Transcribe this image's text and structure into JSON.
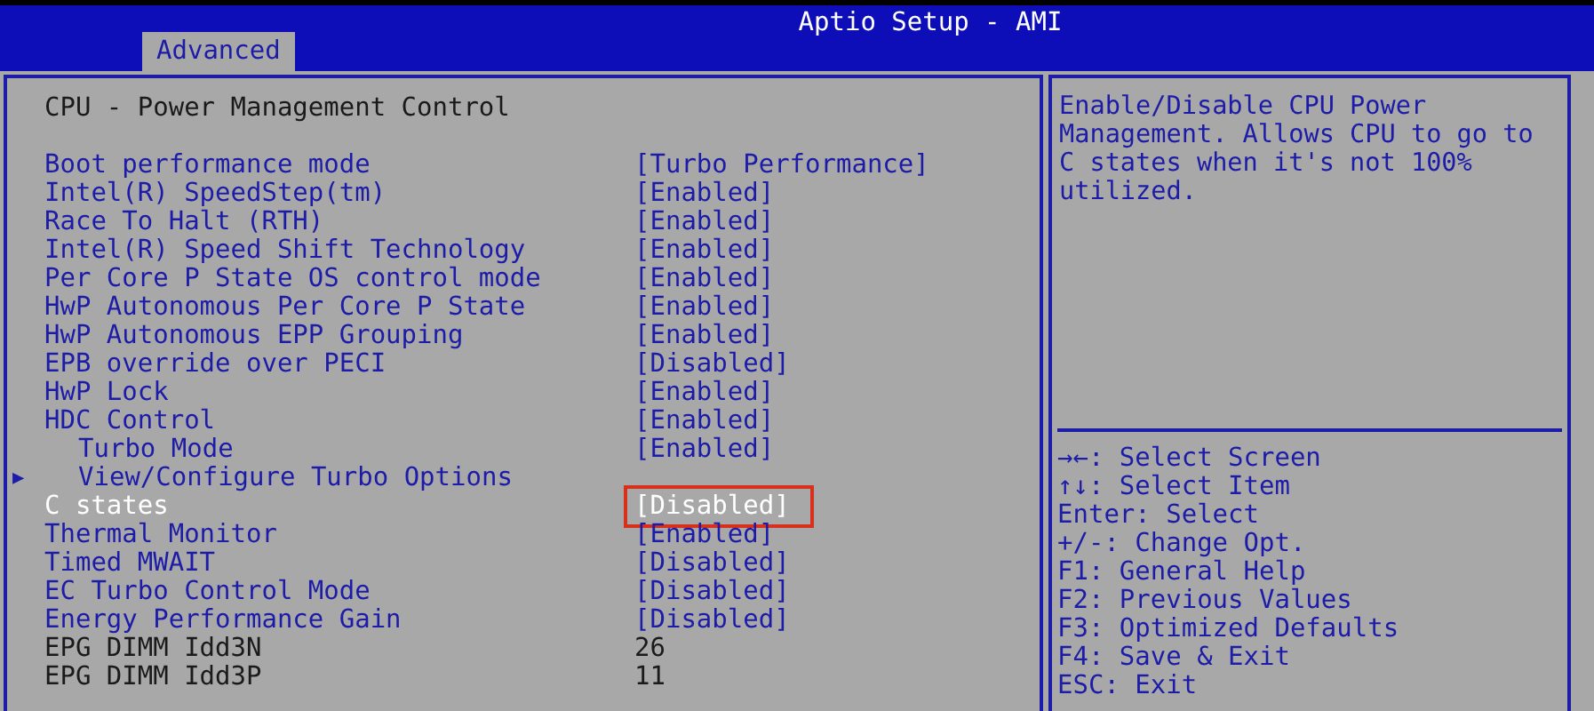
{
  "window": {
    "title": "Aptio Setup - AMI"
  },
  "tabs": [
    {
      "label": "Advanced",
      "selected": true
    }
  ],
  "section_title": "CPU - Power Management Control",
  "settings": [
    {
      "kind": "option",
      "label": "Boot performance mode",
      "value": "[Turbo Performance]",
      "selected": false
    },
    {
      "kind": "option",
      "label": "Intel(R) SpeedStep(tm)",
      "value": "[Enabled]",
      "selected": false
    },
    {
      "kind": "option",
      "label": "Race To Halt (RTH)",
      "value": "[Enabled]",
      "selected": false
    },
    {
      "kind": "option",
      "label": "Intel(R) Speed Shift Technology",
      "value": "[Enabled]",
      "selected": false
    },
    {
      "kind": "option",
      "label": "Per Core P State OS control mode",
      "value": "[Enabled]",
      "selected": false
    },
    {
      "kind": "option",
      "label": "HwP Autonomous Per Core P State",
      "value": "[Enabled]",
      "selected": false
    },
    {
      "kind": "option",
      "label": "HwP Autonomous EPP Grouping",
      "value": "[Enabled]",
      "selected": false
    },
    {
      "kind": "option",
      "label": "EPB override over PECI",
      "value": "[Disabled]",
      "selected": false
    },
    {
      "kind": "option",
      "label": "HwP Lock",
      "value": "[Enabled]",
      "selected": false
    },
    {
      "kind": "option",
      "label": "HDC Control",
      "value": "[Enabled]",
      "selected": false
    },
    {
      "kind": "sub-option",
      "label": "Turbo Mode",
      "value": "[Enabled]",
      "selected": false
    },
    {
      "kind": "submenu",
      "label": "View/Configure Turbo Options",
      "arrow": "▶",
      "selected": false
    },
    {
      "kind": "option",
      "label": "C states",
      "value": "[Disabled]",
      "selected": true,
      "annotated": true
    },
    {
      "kind": "option",
      "label": "Thermal Monitor",
      "value": "[Enabled]",
      "selected": false
    },
    {
      "kind": "option",
      "label": "Timed MWAIT",
      "value": "[Disabled]",
      "selected": false
    },
    {
      "kind": "option",
      "label": "EC Turbo Control Mode",
      "value": "[Disabled]",
      "selected": false
    },
    {
      "kind": "option",
      "label": "Energy Performance Gain",
      "value": "[Disabled]",
      "selected": false
    },
    {
      "kind": "info",
      "label": "EPG DIMM Idd3N",
      "value": "26",
      "selected": false
    },
    {
      "kind": "info",
      "label": "EPG DIMM Idd3P",
      "value": "11",
      "selected": false
    }
  ],
  "help": "Enable/Disable CPU Power Management. Allows CPU to go to C states when it's not 100% utilized.",
  "keys": [
    "→←: Select Screen",
    "↑↓: Select Item",
    "Enter: Select",
    "+/-: Change Opt.",
    "F1: General Help",
    "F2: Previous Values",
    "F3: Optimized Defaults",
    "F4: Save & Exit",
    "ESC: Exit"
  ]
}
